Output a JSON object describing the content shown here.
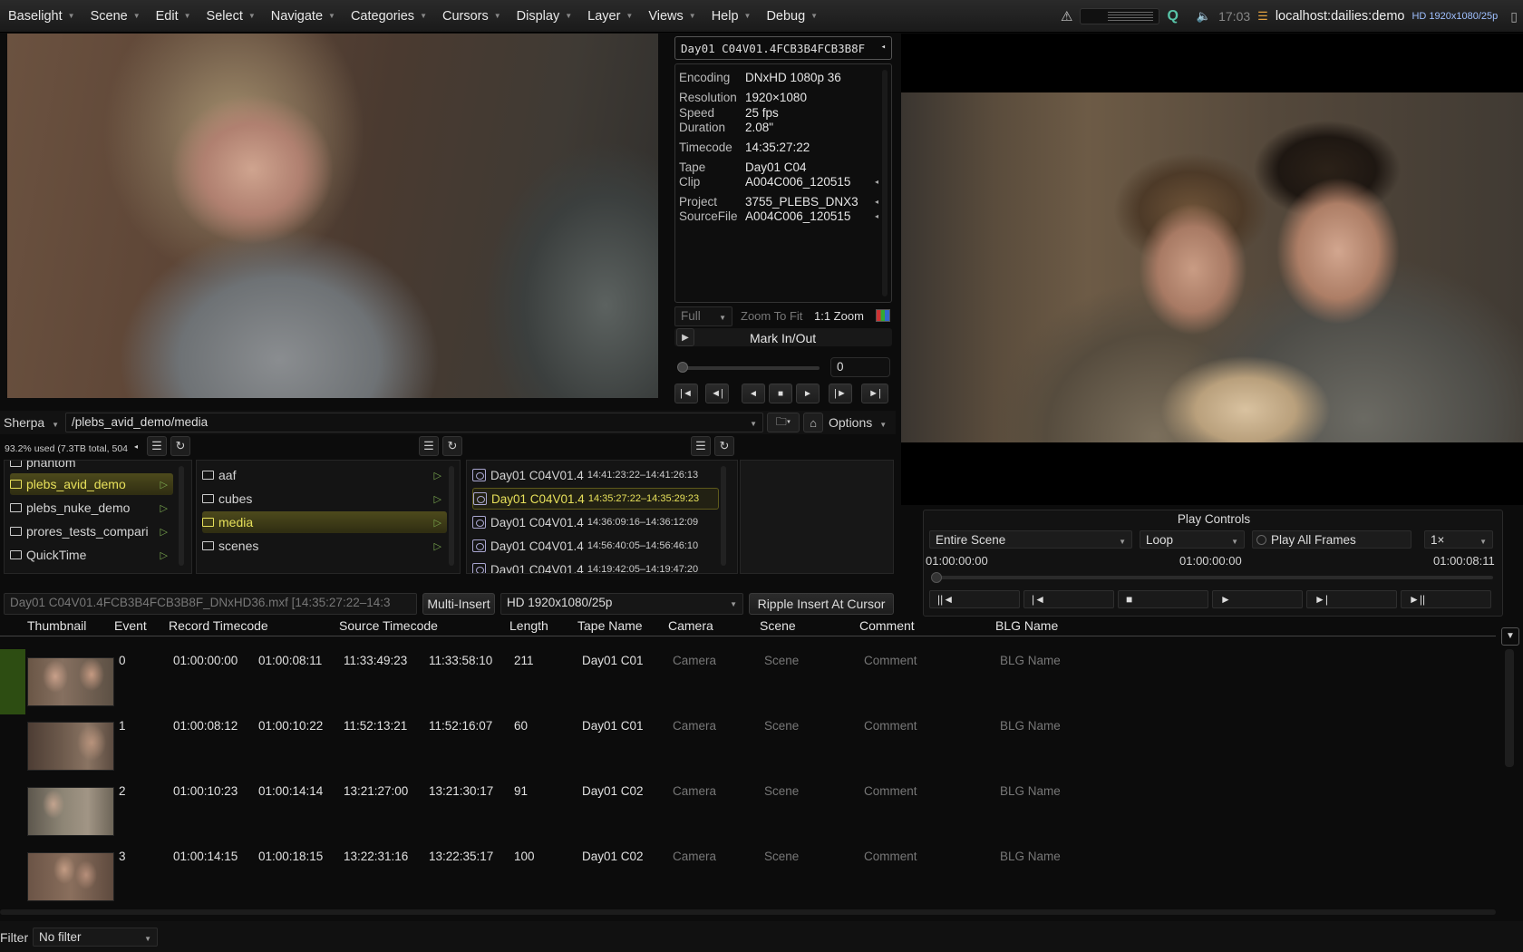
{
  "menu": [
    "Baselight",
    "Scene",
    "Edit",
    "Select",
    "Navigate",
    "Categories",
    "Cursors",
    "Display",
    "Layer",
    "Views",
    "Help",
    "Debug"
  ],
  "status": {
    "time": "17:03",
    "host": "localhost:dailies:demo",
    "format": "HD 1920x1080/25p"
  },
  "clip_selector": "Day01 C04V01.4FCB3B4FCB3B8F",
  "metadata": [
    {
      "key": "Encoding",
      "value": "DNxHD 1080p 36"
    },
    {
      "key": "Resolution",
      "value": "1920×1080"
    },
    {
      "key": "Speed",
      "value": "25 fps"
    },
    {
      "key": "Duration",
      "value": "2.08\""
    },
    {
      "key": "Timecode",
      "value": "14:35:27:22"
    },
    {
      "key": "Tape",
      "value": "Day01 C04"
    },
    {
      "key": "Clip",
      "value": "A004C006_120515"
    },
    {
      "key": "Project",
      "value": "3755_PLEBS_DNX3"
    },
    {
      "key": "SourceFile",
      "value": "A004C006_120515"
    }
  ],
  "viewer_controls": {
    "full": "Full",
    "zoom_fit": "Zoom To Fit",
    "zoom_11": "1:1 Zoom",
    "mark_inout": "Mark In/Out",
    "frame_value": "0"
  },
  "browser": {
    "source": "Sherpa",
    "path": "/plebs_avid_demo/media",
    "options": "Options",
    "disk_usage": "93.2% used (7.3TB total, 504",
    "col1": [
      "phantom",
      "plebs_avid_demo",
      "plebs_nuke_demo",
      "prores_tests_compari",
      "QuickTime"
    ],
    "col1_selected": 1,
    "col2": [
      "aaf",
      "cubes",
      "media",
      "scenes"
    ],
    "col2_selected": 2,
    "clips": [
      {
        "name": "Day01 C04V01.4",
        "tc": "14:41:23:22–14:41:26:13"
      },
      {
        "name": "Day01 C04V01.4",
        "tc": "14:35:27:22–14:35:29:23"
      },
      {
        "name": "Day01 C04V01.4",
        "tc": "14:36:09:16–14:36:12:09"
      },
      {
        "name": "Day01 C04V01.4",
        "tc": "14:56:40:05–14:56:46:10"
      },
      {
        "name": "Day01 C04V01.4",
        "tc": "14:19:42:05–14:19:47:20"
      }
    ],
    "clips_selected": 1
  },
  "insert_bar": {
    "file": "Day01 C04V01.4FCB3B4FCB3B8F_DNxHD36.mxf",
    "range": "[14:35:27:22–14:3",
    "multi_insert": "Multi-Insert",
    "format": "HD 1920x1080/25p",
    "ripple": "Ripple Insert At Cursor"
  },
  "play_controls": {
    "title": "Play Controls",
    "range": "Entire Scene",
    "mode": "Loop",
    "all_frames": "Play All Frames",
    "speed": "1×",
    "tc_start": "01:00:00:00",
    "tc_current": "01:00:00:00",
    "tc_end": "01:00:08:11",
    "transport": [
      "||◄",
      "|◄",
      "■",
      "►",
      "►|",
      "►||"
    ]
  },
  "table": {
    "columns": [
      "Thumbnail",
      "Event",
      "Record Timecode",
      "Source Timecode",
      "Length",
      "Tape Name",
      "Camera",
      "Scene",
      "Comment",
      "BLG Name"
    ],
    "rows": [
      {
        "event": "0",
        "rec_in": "01:00:00:00",
        "rec_out": "01:00:08:11",
        "src_in": "11:33:49:23",
        "src_out": "11:33:58:10",
        "length": "211",
        "tape": "Day01 C01",
        "camera": "Camera",
        "scene": "Scene",
        "comment": "Comment",
        "blg": "BLG Name"
      },
      {
        "event": "1",
        "rec_in": "01:00:08:12",
        "rec_out": "01:00:10:22",
        "src_in": "11:52:13:21",
        "src_out": "11:52:16:07",
        "length": "60",
        "tape": "Day01 C01",
        "camera": "Camera",
        "scene": "Scene",
        "comment": "Comment",
        "blg": "BLG Name"
      },
      {
        "event": "2",
        "rec_in": "01:00:10:23",
        "rec_out": "01:00:14:14",
        "src_in": "13:21:27:00",
        "src_out": "13:21:30:17",
        "length": "91",
        "tape": "Day01 C02",
        "camera": "Camera",
        "scene": "Scene",
        "comment": "Comment",
        "blg": "BLG Name"
      },
      {
        "event": "3",
        "rec_in": "01:00:14:15",
        "rec_out": "01:00:18:15",
        "src_in": "13:22:31:16",
        "src_out": "13:22:35:17",
        "length": "100",
        "tape": "Day01 C02",
        "camera": "Camera",
        "scene": "Scene",
        "comment": "Comment",
        "blg": "BLG Name"
      }
    ]
  },
  "filter": {
    "label": "Filter",
    "value": "No filter"
  },
  "colors": {
    "accent": "#e7e05a",
    "active_row": "#2d4d12",
    "folder_play": "#7aa84f"
  }
}
